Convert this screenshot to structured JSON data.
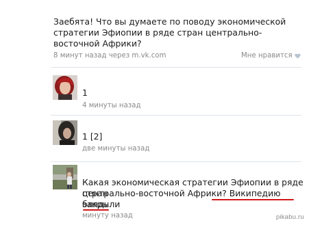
{
  "post": {
    "text": "Заебята! Что вы думаете по поводу экономической стратегии Эфиопии в ряде стран центрально-восточной Африки?",
    "meta": "8 минут назад через m.vk.com",
    "like_label": "Мне нравится",
    "like_icon": "heart-icon"
  },
  "comments": [
    {
      "text": "1",
      "time": "4 минуты назад",
      "avatar_icon": "avatar-red-hair"
    },
    {
      "text": "1 [2]",
      "time": "две минуты назад",
      "avatar_icon": "avatar-dark-hair"
    },
    {
      "text_line1": "Какая экономическая стратегии Эфиопии в ряде стран",
      "text_line2": "центрально-восточной Африки? Википедию закрыли",
      "text_line3": "блядь.",
      "time": "минуту назад",
      "avatar_icon": "avatar-outdoor-photo",
      "underline_color": "#d01818"
    }
  ],
  "watermark": "pikabu.ru"
}
